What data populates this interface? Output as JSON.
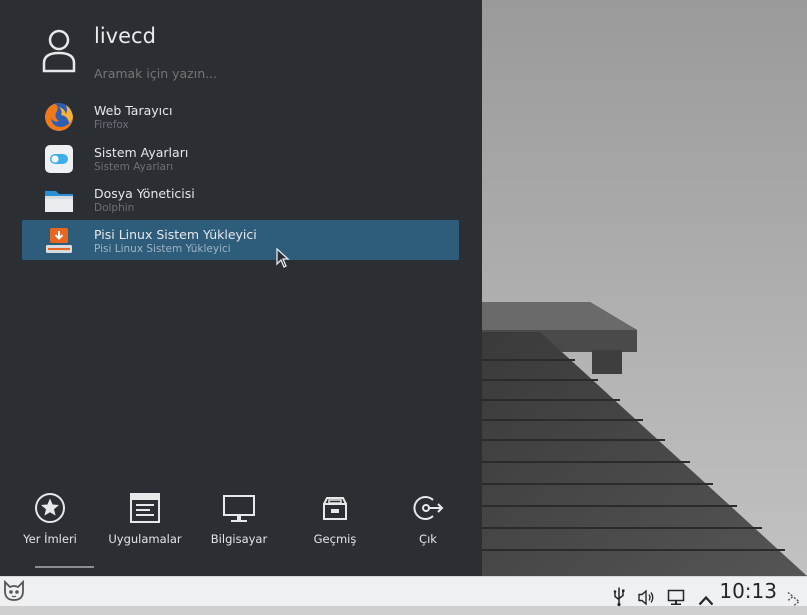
{
  "launcher": {
    "username": "livecd",
    "search_placeholder": "Aramak için yazın...",
    "apps": [
      {
        "name": "Web Tarayıcı",
        "subtitle": "Firefox",
        "icon": "firefox-icon"
      },
      {
        "name": "Sistem Ayarları",
        "subtitle": "Sistem Ayarları",
        "icon": "system-settings-icon"
      },
      {
        "name": "Dosya Yöneticisi",
        "subtitle": "Dolphin",
        "icon": "folder-icon"
      },
      {
        "name": "Pisi Linux Sistem Yükleyici",
        "subtitle": "Pisi Linux Sistem Yükleyici",
        "icon": "installer-icon",
        "selected": true
      }
    ],
    "tabs": [
      {
        "label": "Yer İmleri",
        "icon": "star-icon",
        "active": true
      },
      {
        "label": "Uygulamalar",
        "icon": "applications-icon"
      },
      {
        "label": "Bilgisayar",
        "icon": "computer-icon"
      },
      {
        "label": "Geçmiş",
        "icon": "history-icon"
      },
      {
        "label": "Çık",
        "icon": "leave-icon"
      }
    ]
  },
  "taskbar": {
    "launcher_icon": "pisi-cat-icon",
    "tray_icons": [
      "usb-icon",
      "volume-icon",
      "network-icon",
      "chevron-up-icon"
    ],
    "clock": "10:13",
    "menu_icon": "panel-menu-icon"
  },
  "colors": {
    "panel_bg": "#2b2f33",
    "selection": "#2e5d7b",
    "taskbar_bg": "#eff0f1"
  }
}
